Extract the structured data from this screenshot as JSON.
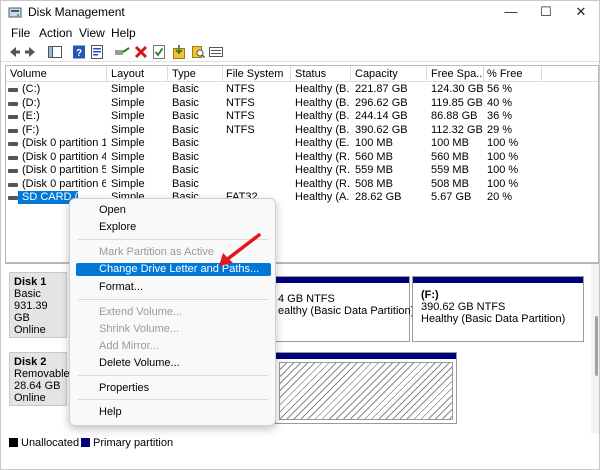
{
  "window": {
    "title": "Disk Management",
    "controls": {
      "minimize": "—",
      "maximize": "☐",
      "close": "✕"
    }
  },
  "menu": {
    "file": "File",
    "action": "Action",
    "view": "View",
    "help": "Help"
  },
  "toolbar": {
    "icons": [
      "back-arrow-icon",
      "forward-arrow-icon",
      "console-tree-icon",
      "help-icon",
      "properties-icon",
      "connect-icon",
      "delete-icon",
      "checklist-icon",
      "import-icon",
      "search-icon",
      "list-icon"
    ]
  },
  "volume_list": {
    "columns": [
      "Volume",
      "Layout",
      "Type",
      "File System",
      "Status",
      "Capacity",
      "Free Spa...",
      "% Free"
    ],
    "rows": [
      {
        "volume": "(C:)",
        "layout": "Simple",
        "type": "Basic",
        "fs": "NTFS",
        "status": "Healthy (B...",
        "capacity": "221.87 GB",
        "free": "124.30 GB",
        "pct": "56 %"
      },
      {
        "volume": "(D:)",
        "layout": "Simple",
        "type": "Basic",
        "fs": "NTFS",
        "status": "Healthy (B...",
        "capacity": "296.62 GB",
        "free": "119.85 GB",
        "pct": "40 %"
      },
      {
        "volume": "(E:)",
        "layout": "Simple",
        "type": "Basic",
        "fs": "NTFS",
        "status": "Healthy (B...",
        "capacity": "244.14 GB",
        "free": "86.88 GB",
        "pct": "36 %"
      },
      {
        "volume": "(F:)",
        "layout": "Simple",
        "type": "Basic",
        "fs": "NTFS",
        "status": "Healthy (B...",
        "capacity": "390.62 GB",
        "free": "112.32 GB",
        "pct": "29 %"
      },
      {
        "volume": "(Disk 0 partition 1)",
        "layout": "Simple",
        "type": "Basic",
        "fs": "",
        "status": "Healthy (E...",
        "capacity": "100 MB",
        "free": "100 MB",
        "pct": "100 %"
      },
      {
        "volume": "(Disk 0 partition 4)",
        "layout": "Simple",
        "type": "Basic",
        "fs": "",
        "status": "Healthy (R...",
        "capacity": "560 MB",
        "free": "560 MB",
        "pct": "100 %"
      },
      {
        "volume": "(Disk 0 partition 5)",
        "layout": "Simple",
        "type": "Basic",
        "fs": "",
        "status": "Healthy (R...",
        "capacity": "559 MB",
        "free": "559 MB",
        "pct": "100 %"
      },
      {
        "volume": "(Disk 0 partition 6)",
        "layout": "Simple",
        "type": "Basic",
        "fs": "",
        "status": "Healthy (R...",
        "capacity": "508 MB",
        "free": "508 MB",
        "pct": "100 %"
      },
      {
        "volume": "SD CARD (H:)",
        "layout": "Simple",
        "type": "Basic",
        "fs": "FAT32",
        "status": "Healthy (A...",
        "capacity": "28.62 GB",
        "free": "5.67 GB",
        "pct": "20 %"
      }
    ]
  },
  "disks": [
    {
      "name": "Disk 1",
      "kind": "Basic",
      "size": "931.39 GB",
      "state": "Online"
    },
    {
      "name": "Disk 2",
      "kind": "Removable",
      "size": "28.64 GB",
      "state": "Online"
    }
  ],
  "partitions": {
    "disk1_mid": {
      "line1": "4 GB NTFS",
      "line2": "ealthy (Basic Data Partition)"
    },
    "disk1_f": {
      "line0": "(F:)",
      "line1": "390.62 GB NTFS",
      "line2": "Healthy (Basic Data Partition)"
    }
  },
  "legend": {
    "unallocated": "Unallocated",
    "primary": "Primary partition"
  },
  "context_menu": {
    "open": "Open",
    "explore": "Explore",
    "mark_active": "Mark Partition as Active",
    "change_letter": "Change Drive Letter and Paths...",
    "format": "Format...",
    "extend": "Extend Volume...",
    "shrink": "Shrink Volume...",
    "add_mirror": "Add Mirror...",
    "delete": "Delete Volume...",
    "properties": "Properties",
    "help": "Help"
  },
  "colors": {
    "accent": "#0078d7",
    "primary_partition": "#00007f",
    "annotation_arrow": "#e3161b"
  }
}
